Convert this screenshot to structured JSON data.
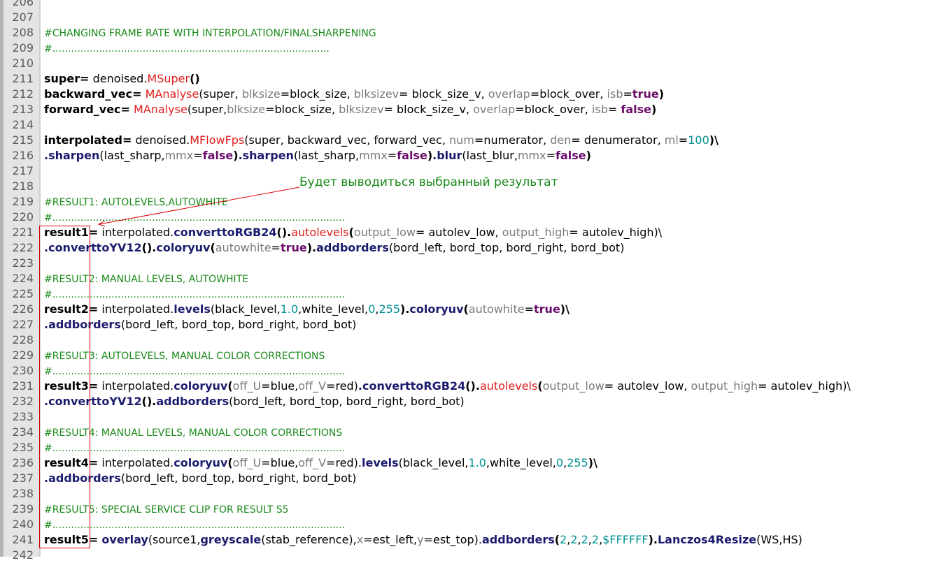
{
  "editor": {
    "lines": [
      {
        "num": "206",
        "segs": []
      },
      {
        "num": "207",
        "segs": []
      },
      {
        "num": "208",
        "segs": [
          {
            "t": "#CHANGING FRAME RATE WITH INTERPOLATION/FINALSHARPENING",
            "c": "cm"
          }
        ]
      },
      {
        "num": "209",
        "segs": [
          {
            "t": "#.........................................................................................",
            "c": "cm"
          }
        ]
      },
      {
        "num": "210",
        "segs": []
      },
      {
        "num": "211",
        "segs": [
          {
            "t": "super=",
            "c": "k"
          },
          {
            "t": " denoised.",
            "c": ""
          },
          {
            "t": "MSuper",
            "c": "r"
          },
          {
            "t": "()",
            "c": "k"
          }
        ]
      },
      {
        "num": "212",
        "segs": [
          {
            "t": "backward_vec=",
            "c": "k"
          },
          {
            "t": " ",
            "c": ""
          },
          {
            "t": "MAnalyse",
            "c": "r"
          },
          {
            "t": "(super, ",
            "c": ""
          },
          {
            "t": "blksize",
            "c": "p"
          },
          {
            "t": "=block_size, ",
            "c": ""
          },
          {
            "t": "blksizev",
            "c": "p"
          },
          {
            "t": "= block_size_v, ",
            "c": ""
          },
          {
            "t": "overlap",
            "c": "p"
          },
          {
            "t": "=block_over, ",
            "c": ""
          },
          {
            "t": "isb",
            "c": "p"
          },
          {
            "t": "=",
            "c": ""
          },
          {
            "t": "true",
            "c": "b"
          },
          {
            "t": ")",
            "c": "k"
          }
        ]
      },
      {
        "num": "213",
        "segs": [
          {
            "t": "forward_vec=",
            "c": "k"
          },
          {
            "t": " ",
            "c": ""
          },
          {
            "t": "MAnalyse",
            "c": "r"
          },
          {
            "t": "(super,",
            "c": ""
          },
          {
            "t": "blksize",
            "c": "p"
          },
          {
            "t": "=block_size, ",
            "c": ""
          },
          {
            "t": "blksizev",
            "c": "p"
          },
          {
            "t": "= block_size_v, ",
            "c": ""
          },
          {
            "t": "overlap",
            "c": "p"
          },
          {
            "t": "=block_over, ",
            "c": ""
          },
          {
            "t": "isb",
            "c": "p"
          },
          {
            "t": "= ",
            "c": ""
          },
          {
            "t": "false",
            "c": "b"
          },
          {
            "t": ")",
            "c": "k"
          }
        ]
      },
      {
        "num": "214",
        "segs": []
      },
      {
        "num": "215",
        "segs": [
          {
            "t": "interpolated=",
            "c": "k"
          },
          {
            "t": " denoised.",
            "c": ""
          },
          {
            "t": "MFlowFps",
            "c": "r"
          },
          {
            "t": "(super, backward_vec, forward_vec, ",
            "c": ""
          },
          {
            "t": "num",
            "c": "p"
          },
          {
            "t": "=numerator, ",
            "c": ""
          },
          {
            "t": "den",
            "c": "p"
          },
          {
            "t": "= denumerator, ",
            "c": ""
          },
          {
            "t": "ml",
            "c": "p"
          },
          {
            "t": "=",
            "c": ""
          },
          {
            "t": "100",
            "c": "n"
          },
          {
            "t": ")\\",
            "c": "k"
          }
        ]
      },
      {
        "num": "216",
        "segs": [
          {
            "t": ".sharpen",
            "c": "f"
          },
          {
            "t": "(last_sharp,",
            "c": ""
          },
          {
            "t": "mmx",
            "c": "p"
          },
          {
            "t": "=",
            "c": ""
          },
          {
            "t": "false",
            "c": "b"
          },
          {
            "t": ")",
            "c": "k"
          },
          {
            "t": ".sharpen",
            "c": "f"
          },
          {
            "t": "(last_sharp,",
            "c": ""
          },
          {
            "t": "mmx",
            "c": "p"
          },
          {
            "t": "=",
            "c": ""
          },
          {
            "t": "false",
            "c": "b"
          },
          {
            "t": ")",
            "c": "k"
          },
          {
            "t": ".blur",
            "c": "f"
          },
          {
            "t": "(last_blur,",
            "c": ""
          },
          {
            "t": "mmx",
            "c": "p"
          },
          {
            "t": "=",
            "c": ""
          },
          {
            "t": "false",
            "c": "b"
          },
          {
            "t": ")",
            "c": "k"
          }
        ]
      },
      {
        "num": "217",
        "segs": []
      },
      {
        "num": "218",
        "segs": []
      },
      {
        "num": "219",
        "segs": [
          {
            "t": "#RESULT1: AUTOLEVELS,AUTOWHITE",
            "c": "cm"
          }
        ]
      },
      {
        "num": "220",
        "segs": [
          {
            "t": "#..............................................................................................",
            "c": "cm"
          }
        ]
      },
      {
        "num": "221",
        "segs": [
          {
            "t": "result1=",
            "c": "k"
          },
          {
            "t": " interpolated.",
            "c": ""
          },
          {
            "t": "converttoRGB24",
            "c": "f"
          },
          {
            "t": "().",
            "c": "k"
          },
          {
            "t": "autolevels",
            "c": "r"
          },
          {
            "t": "(",
            "c": "k"
          },
          {
            "t": "output_low",
            "c": "p"
          },
          {
            "t": "= autolev_low, ",
            "c": ""
          },
          {
            "t": "output_high",
            "c": "p"
          },
          {
            "t": "= autolev_high)\\",
            "c": ""
          }
        ]
      },
      {
        "num": "222",
        "segs": [
          {
            "t": ".converttoYV12",
            "c": "f"
          },
          {
            "t": "().",
            "c": "k"
          },
          {
            "t": "coloryuv",
            "c": "f"
          },
          {
            "t": "(",
            "c": "k"
          },
          {
            "t": "autowhite",
            "c": "p"
          },
          {
            "t": "=",
            "c": ""
          },
          {
            "t": "true",
            "c": "b"
          },
          {
            "t": ").",
            "c": "k"
          },
          {
            "t": "addborders",
            "c": "f"
          },
          {
            "t": "(bord_left, bord_top, bord_right, bord_bot)",
            "c": ""
          }
        ]
      },
      {
        "num": "223",
        "segs": []
      },
      {
        "num": "224",
        "segs": [
          {
            "t": "#RESULT2: MANUAL LEVELS, AUTOWHITE",
            "c": "cm"
          }
        ]
      },
      {
        "num": "225",
        "segs": [
          {
            "t": "#..............................................................................................",
            "c": "cm"
          }
        ]
      },
      {
        "num": "226",
        "segs": [
          {
            "t": "result2=",
            "c": "k"
          },
          {
            "t": " interpolated.",
            "c": ""
          },
          {
            "t": "levels",
            "c": "f"
          },
          {
            "t": "(black_level,",
            "c": ""
          },
          {
            "t": "1.0",
            "c": "n"
          },
          {
            "t": ",white_level,",
            "c": ""
          },
          {
            "t": "0",
            "c": "n"
          },
          {
            "t": ",",
            "c": ""
          },
          {
            "t": "255",
            "c": "n"
          },
          {
            "t": ").",
            "c": "k"
          },
          {
            "t": "coloryuv",
            "c": "f"
          },
          {
            "t": "(",
            "c": "k"
          },
          {
            "t": "autowhite",
            "c": "p"
          },
          {
            "t": "=",
            "c": ""
          },
          {
            "t": "true",
            "c": "b"
          },
          {
            "t": ")\\",
            "c": "k"
          }
        ]
      },
      {
        "num": "227",
        "segs": [
          {
            "t": ".addborders",
            "c": "f"
          },
          {
            "t": "(bord_left, bord_top, bord_right, bord_bot)",
            "c": ""
          }
        ]
      },
      {
        "num": "228",
        "segs": []
      },
      {
        "num": "229",
        "segs": [
          {
            "t": "#RESULT3: AUTOLEVELS, MANUAL COLOR CORRECTIONS",
            "c": "cm"
          }
        ]
      },
      {
        "num": "230",
        "segs": [
          {
            "t": "#..............................................................................................",
            "c": "cm"
          }
        ]
      },
      {
        "num": "231",
        "segs": [
          {
            "t": "result3=",
            "c": "k"
          },
          {
            "t": " interpolated.",
            "c": ""
          },
          {
            "t": "coloryuv",
            "c": "f"
          },
          {
            "t": "(",
            "c": "k"
          },
          {
            "t": "off_U",
            "c": "p"
          },
          {
            "t": "=blue,",
            "c": ""
          },
          {
            "t": "off_V",
            "c": "p"
          },
          {
            "t": "=red)",
            "c": ""
          },
          {
            "t": ".converttoRGB24",
            "c": "f"
          },
          {
            "t": "().",
            "c": "k"
          },
          {
            "t": "autolevels",
            "c": "r"
          },
          {
            "t": "(",
            "c": "k"
          },
          {
            "t": "output_low",
            "c": "p"
          },
          {
            "t": "= autolev_low, ",
            "c": ""
          },
          {
            "t": "output_high",
            "c": "p"
          },
          {
            "t": "= autolev_high)\\",
            "c": ""
          }
        ]
      },
      {
        "num": "232",
        "segs": [
          {
            "t": ".converttoYV12",
            "c": "f"
          },
          {
            "t": "().",
            "c": "k"
          },
          {
            "t": "addborders",
            "c": "f"
          },
          {
            "t": "(bord_left, bord_top, bord_right, bord_bot)",
            "c": ""
          }
        ]
      },
      {
        "num": "233",
        "segs": []
      },
      {
        "num": "234",
        "segs": [
          {
            "t": "#RESULT4: MANUAL LEVELS, MANUAL COLOR CORRECTIONS",
            "c": "cm"
          }
        ]
      },
      {
        "num": "235",
        "segs": [
          {
            "t": "#..............................................................................................",
            "c": "cm"
          }
        ]
      },
      {
        "num": "236",
        "segs": [
          {
            "t": "result4=",
            "c": "k"
          },
          {
            "t": " interpolated.",
            "c": ""
          },
          {
            "t": "coloryuv",
            "c": "f"
          },
          {
            "t": "(",
            "c": "k"
          },
          {
            "t": "off_U",
            "c": "p"
          },
          {
            "t": "=blue,",
            "c": ""
          },
          {
            "t": "off_V",
            "c": "p"
          },
          {
            "t": "=red).",
            "c": ""
          },
          {
            "t": "levels",
            "c": "f"
          },
          {
            "t": "(black_level,",
            "c": ""
          },
          {
            "t": "1.0",
            "c": "n"
          },
          {
            "t": ",white_level,",
            "c": ""
          },
          {
            "t": "0",
            "c": "n"
          },
          {
            "t": ",",
            "c": ""
          },
          {
            "t": "255",
            "c": "n"
          },
          {
            "t": ")\\",
            "c": "k"
          }
        ]
      },
      {
        "num": "237",
        "segs": [
          {
            "t": ".addborders",
            "c": "f"
          },
          {
            "t": "(bord_left, bord_top, bord_right, bord_bot)",
            "c": ""
          }
        ]
      },
      {
        "num": "238",
        "segs": []
      },
      {
        "num": "239",
        "segs": [
          {
            "t": "#RESULT5: SPECIAL SERVICE CLIP FOR RESULT S5",
            "c": "cm"
          }
        ]
      },
      {
        "num": "240",
        "segs": [
          {
            "t": "#..............................................................................................",
            "c": "cm"
          }
        ]
      },
      {
        "num": "241",
        "segs": [
          {
            "t": "result5=",
            "c": "k"
          },
          {
            "t": " ",
            "c": ""
          },
          {
            "t": "overlay",
            "c": "f"
          },
          {
            "t": "(source1,",
            "c": ""
          },
          {
            "t": "greyscale",
            "c": "f"
          },
          {
            "t": "(stab_reference),",
            "c": ""
          },
          {
            "t": "x",
            "c": "p"
          },
          {
            "t": "=est_left,",
            "c": ""
          },
          {
            "t": "y",
            "c": "p"
          },
          {
            "t": "=est_top).",
            "c": ""
          },
          {
            "t": "addborders",
            "c": "f"
          },
          {
            "t": "(",
            "c": "k"
          },
          {
            "t": "2",
            "c": "n"
          },
          {
            "t": ",",
            "c": ""
          },
          {
            "t": "2",
            "c": "n"
          },
          {
            "t": ",",
            "c": ""
          },
          {
            "t": "2",
            "c": "n"
          },
          {
            "t": ",",
            "c": ""
          },
          {
            "t": "2",
            "c": "n"
          },
          {
            "t": ",",
            "c": ""
          },
          {
            "t": "$FFFFFF",
            "c": "n"
          },
          {
            "t": ").",
            "c": "k"
          },
          {
            "t": "Lanczos4Resize",
            "c": "f"
          },
          {
            "t": "(WS,HS)",
            "c": ""
          }
        ]
      },
      {
        "num": "242",
        "segs": []
      }
    ]
  },
  "annotation": {
    "text": "Будет выводиться выбранный результат",
    "color": "#168816",
    "highlight_color": "#d80000"
  }
}
